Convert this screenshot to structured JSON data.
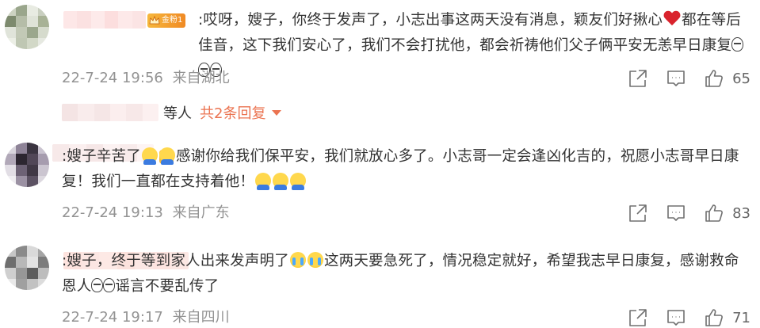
{
  "comments": [
    {
      "badge": "金粉1",
      "text_parts": [
        {
          "t": ":哎呀，嫂子，你终于发声了，小志出事这两天没有消息，颖友们好揪心"
        },
        {
          "e": "heart"
        },
        {
          "t": "都在等后佳音，这下我们安心了，我们不会打扰他，都会祈祷他们父子俩平安无恙早日康复"
        },
        {
          "e": "sob"
        },
        {
          "e": "sob"
        },
        {
          "e": "sob"
        }
      ],
      "date": "22-7-24 19:56",
      "location": "来自湖北",
      "likes": "65"
    },
    {
      "badge": "",
      "text_parts": [
        {
          "t": ":嫂子辛苦了"
        },
        {
          "e": "hug"
        },
        {
          "e": "hug"
        },
        {
          "t": "感谢你给我们保平安，我们就放心多了。小志哥一定会逢凶化吉的，祝愿小志哥早日康复！我们一直都在支持着他！"
        },
        {
          "e": "hug"
        },
        {
          "e": "hug"
        },
        {
          "e": "hug"
        }
      ],
      "date": "22-7-24 19:13",
      "location": "来自广东",
      "likes": "83"
    },
    {
      "badge": "",
      "text_parts": [
        {
          "t": ":嫂子，终于等到家人出来发声明了"
        },
        {
          "e": "cry"
        },
        {
          "e": "cry"
        },
        {
          "t": "这两天要急死了，情况稳定就好，希望我志早日康复，感谢救命恩人"
        },
        {
          "e": "sob"
        },
        {
          "e": "sob"
        },
        {
          "t": "谣言不要乱传了"
        }
      ],
      "date": "22-7-24 19:17",
      "location": "来自四川",
      "likes": "71"
    }
  ],
  "reply_bar": {
    "suffix": "等人",
    "link": "共2条回复"
  },
  "icons": [
    "share-icon",
    "comment-icon",
    "like-icon",
    "caret-down-icon",
    "crown-icon"
  ],
  "colors": {
    "meta": "#939393",
    "link": "#eb7350",
    "text": "#333333"
  }
}
